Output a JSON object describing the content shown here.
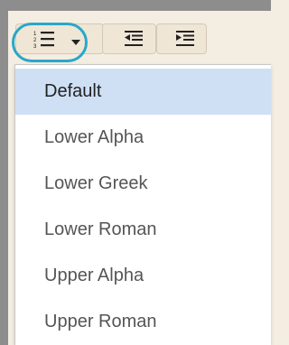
{
  "toolbar": {
    "buttons": [
      {
        "icon": "ordered-list-icon"
      },
      {
        "icon": "chevron-down-icon"
      },
      {
        "icon": "outdent-icon"
      },
      {
        "icon": "indent-icon"
      }
    ],
    "list_numbers": [
      "1",
      "2",
      "3"
    ],
    "highlight_color": "#2aa7c7"
  },
  "menu": {
    "items": [
      {
        "label": "Default",
        "selected": true
      },
      {
        "label": "Lower Alpha",
        "selected": false
      },
      {
        "label": "Lower Greek",
        "selected": false
      },
      {
        "label": "Lower Roman",
        "selected": false
      },
      {
        "label": "Upper Alpha",
        "selected": false
      },
      {
        "label": "Upper Roman",
        "selected": false
      }
    ],
    "selected_color": "#cfe0f4"
  }
}
